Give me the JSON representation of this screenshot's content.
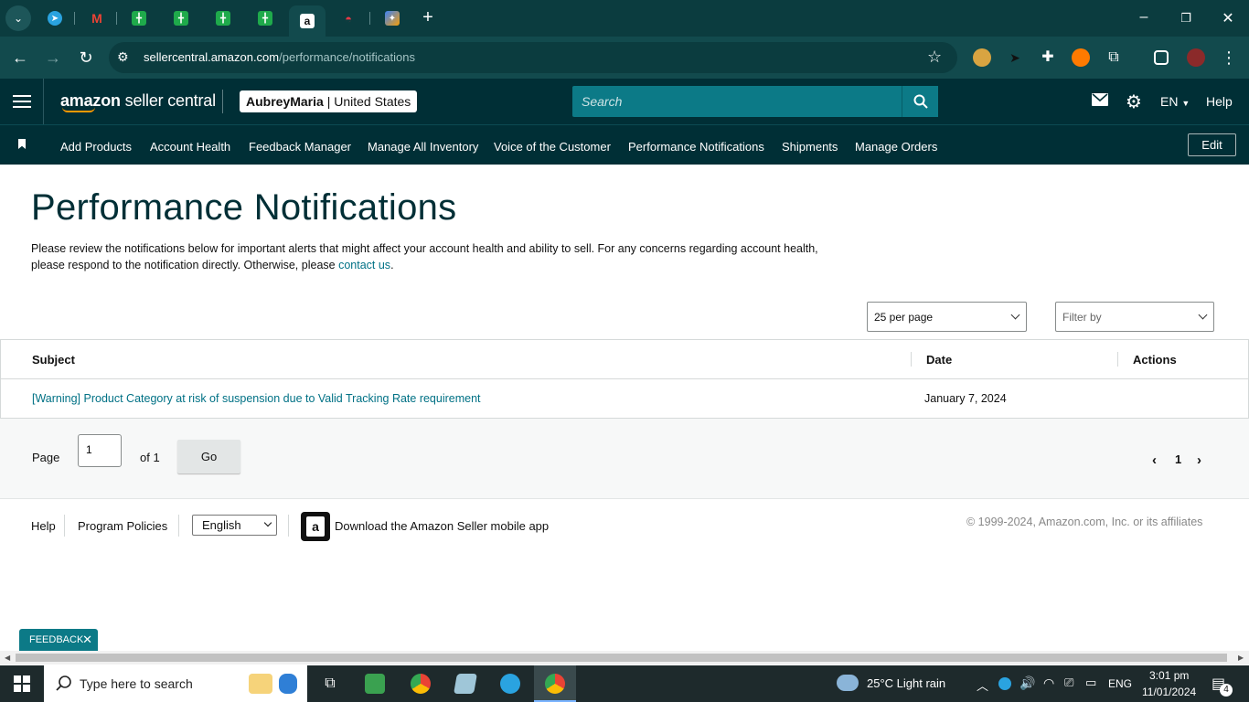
{
  "browser": {
    "url_host": "sellercentral.amazon.com",
    "url_path": "/performance/notifications",
    "tabs": [
      {
        "icon": "telegram-icon",
        "color": "#2aa3e0"
      },
      {
        "icon": "gmail-icon",
        "color": "#ea4335"
      },
      {
        "icon": "sheets-icon",
        "color": "#1faa4b"
      },
      {
        "icon": "sheets-icon",
        "color": "#1faa4b"
      },
      {
        "icon": "sheets-icon",
        "color": "#1faa4b"
      },
      {
        "icon": "sheets-icon",
        "color": "#1faa4b"
      },
      {
        "icon": "amazon-icon",
        "color": "#ffffff"
      },
      {
        "icon": "speedometer-icon",
        "color": "#e63946"
      },
      {
        "icon": "app-icon",
        "color": "#f59e0b"
      }
    ]
  },
  "header": {
    "logo_main": "amazon",
    "logo_sub": "seller central",
    "account_name": "AubreyMaria",
    "account_sep": "|",
    "marketplace": "United States",
    "search_placeholder": "Search",
    "language": "EN",
    "help": "Help"
  },
  "nav": {
    "items": [
      "Add Products",
      "Account Health",
      "Feedback Manager",
      "Manage All Inventory",
      "Voice of the Customer",
      "Performance Notifications",
      "Shipments",
      "Manage Orders"
    ],
    "edit": "Edit"
  },
  "page": {
    "title": "Performance Notifications",
    "description": "Please review the notifications below for important alerts that might affect your account health and ability to sell. For any concerns regarding account health, please respond to the notification directly. Otherwise, please ",
    "contact_link": "contact us",
    "description_end": ".",
    "per_page": "25 per page",
    "filter_placeholder": "Filter by"
  },
  "table": {
    "headers": [
      "Subject",
      "Date",
      "Actions"
    ],
    "rows": [
      {
        "subject": "[Warning] Product Category at risk of suspension due to Valid Tracking Rate requirement",
        "date": "January 7, 2024",
        "actions": ""
      }
    ]
  },
  "pagination": {
    "page_label": "Page",
    "page_value": "1",
    "of_label": "of 1",
    "go": "Go",
    "current": "1"
  },
  "footer": {
    "help": "Help",
    "program_policies": "Program Policies",
    "language": "English",
    "app_text": "Download the Amazon Seller mobile app",
    "copyright": "© 1999-2024, Amazon.com, Inc. or its affiliates",
    "feedback": "FEEDBACK"
  },
  "taskbar": {
    "search_placeholder": "Type here to search",
    "weather": "25°C  Light rain",
    "lang": "ENG",
    "time": "3:01 pm",
    "date": "11/01/2024",
    "notif_count": "4"
  }
}
